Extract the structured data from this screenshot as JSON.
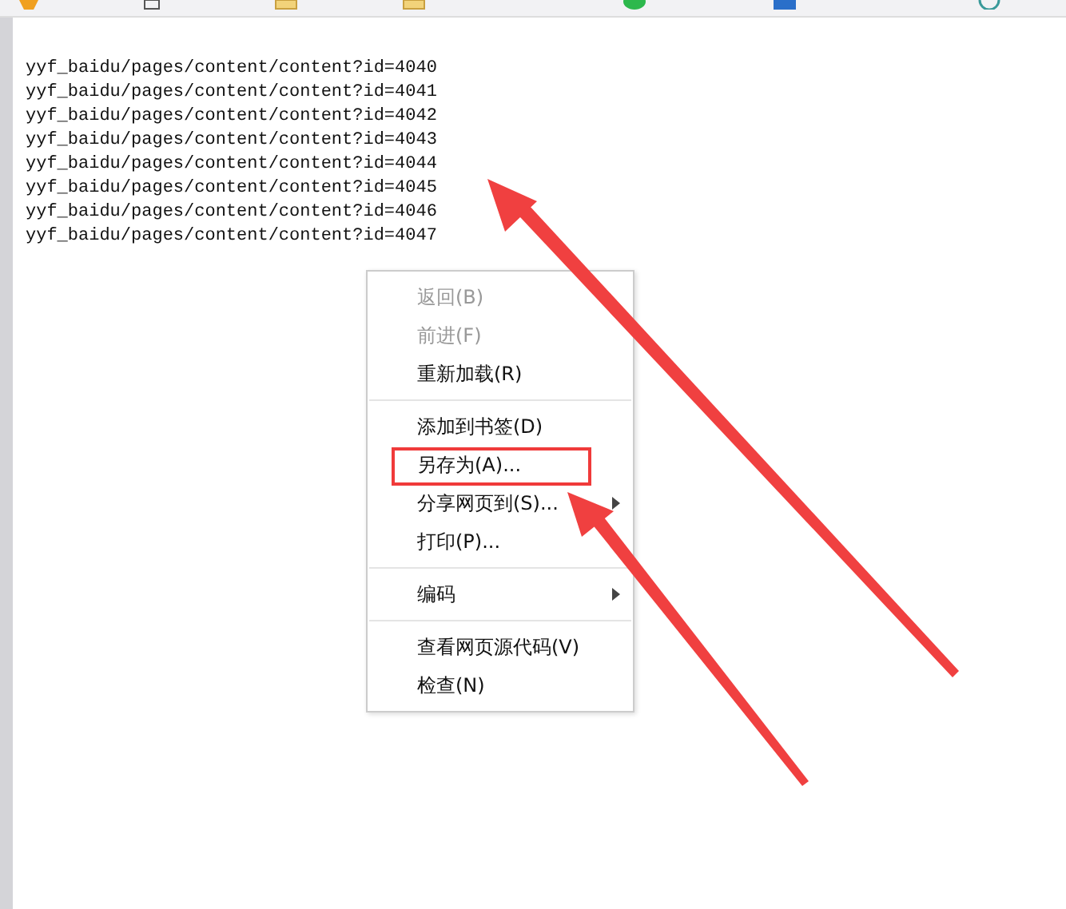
{
  "lines": [
    "yyf_baidu/pages/content/content?id=4040",
    "yyf_baidu/pages/content/content?id=4041",
    "yyf_baidu/pages/content/content?id=4042",
    "yyf_baidu/pages/content/content?id=4043",
    "yyf_baidu/pages/content/content?id=4044",
    "yyf_baidu/pages/content/content?id=4045",
    "yyf_baidu/pages/content/content?id=4046",
    "yyf_baidu/pages/content/content?id=4047"
  ],
  "context_menu": {
    "groups": [
      [
        {
          "label": "返回(B)",
          "disabled": true
        },
        {
          "label": "前进(F)",
          "disabled": true
        },
        {
          "label": "重新加载(R)",
          "disabled": false
        }
      ],
      [
        {
          "label": "添加到书签(D)",
          "disabled": false
        },
        {
          "label": "另存为(A)...",
          "disabled": false,
          "highlighted": true
        },
        {
          "label": "分享网页到(S)...",
          "disabled": false,
          "submenu": true
        },
        {
          "label": "打印(P)...",
          "disabled": false
        }
      ],
      [
        {
          "label": "编码",
          "disabled": false,
          "submenu": true
        }
      ],
      [
        {
          "label": "查看网页源代码(V)",
          "disabled": false
        },
        {
          "label": "检查(N)",
          "disabled": false
        }
      ]
    ]
  }
}
